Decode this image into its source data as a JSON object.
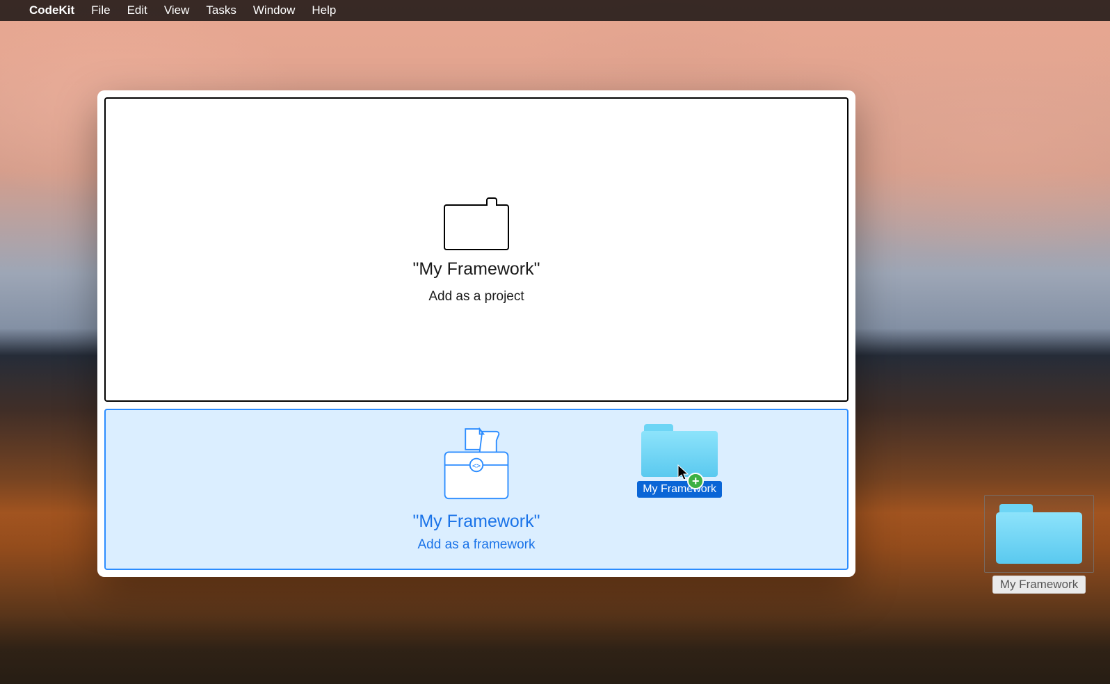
{
  "menu": {
    "app_name": "CodeKit",
    "items": [
      "File",
      "Edit",
      "View",
      "Tasks",
      "Window",
      "Help"
    ]
  },
  "drop_project": {
    "title": "\"My Framework\"",
    "subtitle": "Add as a project"
  },
  "drop_framework": {
    "title": "\"My Framework\"",
    "subtitle": "Add as a framework"
  },
  "dragged_folder": {
    "label": "My Framework"
  },
  "desktop_folder": {
    "label": "My Framework"
  }
}
